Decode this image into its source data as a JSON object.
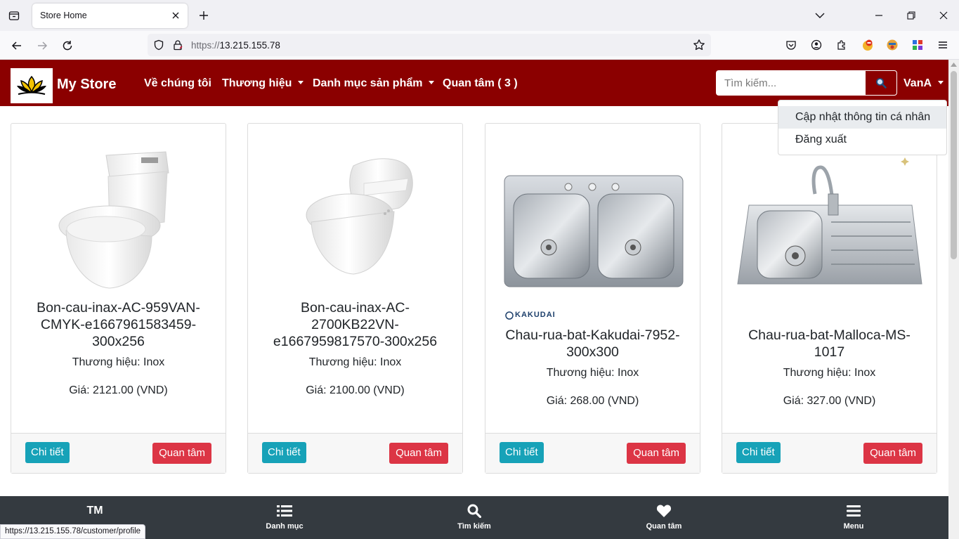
{
  "browser": {
    "tab_title": "Store Home",
    "url_scheme": "https://",
    "url_host": "13.215.155.78",
    "status_url": "https://13.215.155.78/customer/profile"
  },
  "header": {
    "brand": "My Store",
    "nav": {
      "about": "Về chúng tôi",
      "brands": "Thương hiệu",
      "categories": "Danh mục sản phẩm",
      "favorites": "Quan tâm ( 3 )"
    },
    "search_placeholder": "Tìm kiếm...",
    "user": "VanA"
  },
  "user_dropdown": {
    "items": [
      "Cập nhật thông tin cá nhân",
      "Đăng xuất"
    ]
  },
  "products": [
    {
      "title": "Bon-cau-inax-AC-959VAN-CMYK-e1667961583459-300x256",
      "brand": "Thương hiệu: Inox",
      "price": "Giá: 2121.00 (VND)",
      "image": "toilet-icon"
    },
    {
      "title": "Bon-cau-inax-AC-2700KB22VN-e1667959817570-300x256",
      "brand": "Thương hiệu: Inox",
      "price": "Giá: 2100.00 (VND)",
      "image": "smart-toilet-icon"
    },
    {
      "title": "Chau-rua-bat-Kakudai-7952-300x300",
      "brand": "Thương hiệu: Inox",
      "price": "Giá: 268.00 (VND)",
      "image": "double-sink-icon",
      "watermark": "KAKUDAI"
    },
    {
      "title": "Chau-rua-bat-Malloca-MS-1017",
      "brand": "Thương hiệu: Inox",
      "price": "Giá: 327.00 (VND)",
      "image": "sink-with-faucet-icon"
    }
  ],
  "card_buttons": {
    "detail": "Chi tiết",
    "favorite": "Quan tâm"
  },
  "bottom_nav": {
    "home": "TM",
    "categories": "Danh mục",
    "search": "Tìm kiếm",
    "favorites": "Quan tâm",
    "menu": "Menu"
  },
  "colors": {
    "header_bg": "#8b0000",
    "detail_btn": "#17a2b8",
    "fav_btn": "#dc3545",
    "bottom_nav_bg": "#343a40"
  }
}
